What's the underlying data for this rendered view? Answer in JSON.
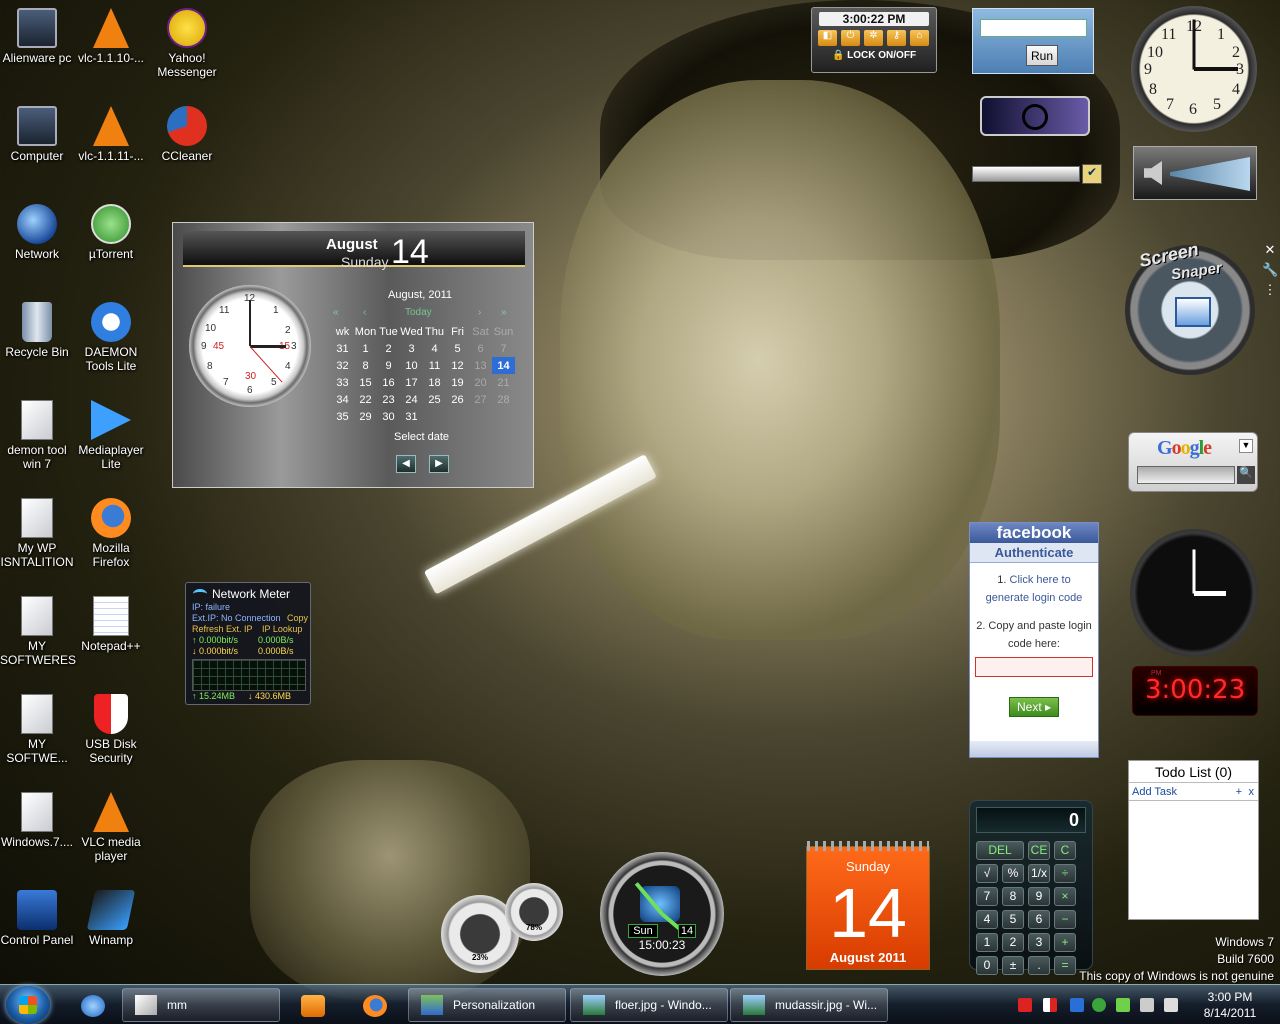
{
  "desktop_icons": [
    {
      "label": "Alienware pc",
      "icon": "monitor-icon"
    },
    {
      "label": "vlc-1.1.10-...",
      "icon": "vlc-icon"
    },
    {
      "label": "Yahoo! Messenger",
      "icon": "yahoo-messenger-icon"
    },
    {
      "label": "Computer",
      "icon": "computer-icon"
    },
    {
      "label": "vlc-1.1.11-...",
      "icon": "vlc-icon"
    },
    {
      "label": "CCleaner",
      "icon": "ccleaner-icon"
    },
    {
      "label": "Network",
      "icon": "network-icon"
    },
    {
      "label": "µTorrent",
      "icon": "utorrent-icon"
    },
    {
      "label": "Recycle Bin",
      "icon": "recycle-bin-icon"
    },
    {
      "label": "DAEMON Tools Lite",
      "icon": "daemon-tools-icon"
    },
    {
      "label": "demon tool win 7",
      "icon": "shortcut-doc-icon"
    },
    {
      "label": "Mediaplayer Lite",
      "icon": "mediaplayer-icon"
    },
    {
      "label": "My  WP ISNTALITION",
      "icon": "shortcut-doc-icon"
    },
    {
      "label": "Mozilla Firefox",
      "icon": "firefox-icon"
    },
    {
      "label": "MY SOFTWERES",
      "icon": "shortcut-doc-icon"
    },
    {
      "label": "Notepad++",
      "icon": "notepad-icon"
    },
    {
      "label": "MY SOFTWE...",
      "icon": "shortcut-doc-icon"
    },
    {
      "label": "USB Disk Security",
      "icon": "usb-disk-security-icon"
    },
    {
      "label": "Windows.7....",
      "icon": "shortcut-doc-icon"
    },
    {
      "label": "VLC media player",
      "icon": "vlc-icon"
    },
    {
      "label": "Control Panel",
      "icon": "control-panel-icon"
    },
    {
      "label": "Winamp",
      "icon": "winamp-icon"
    }
  ],
  "lock_gadget": {
    "time": "3:00:22 PM",
    "lock_label": "LOCK ON/OFF"
  },
  "run_gadget": {
    "button": "Run",
    "value": ""
  },
  "calendar_gadget": {
    "month": "August",
    "weekday": "Sunday",
    "day": "14",
    "month_year": "August, 2011",
    "today": "Today",
    "week_headers": [
      "wk",
      "Mon",
      "Tue",
      "Wed",
      "Thu",
      "Fri",
      "Sat",
      "Sun"
    ],
    "rows": [
      [
        "31",
        "1",
        "2",
        "3",
        "4",
        "5",
        "6",
        "7"
      ],
      [
        "32",
        "8",
        "9",
        "10",
        "11",
        "12",
        "13",
        "14"
      ],
      [
        "33",
        "15",
        "16",
        "17",
        "18",
        "19",
        "20",
        "21"
      ],
      [
        "34",
        "22",
        "23",
        "24",
        "25",
        "26",
        "27",
        "28"
      ],
      [
        "35",
        "29",
        "30",
        "31",
        "",
        "",
        "",
        ""
      ]
    ],
    "selected_date": "14",
    "select_date": "Select date",
    "clock_numbers": [
      "12",
      "1",
      "2",
      "3",
      "4",
      "5",
      "6",
      "7",
      "8",
      "9",
      "10",
      "11"
    ],
    "clock_red_marks": [
      "15",
      "30",
      "45"
    ]
  },
  "network_meter": {
    "title": "Network Meter",
    "ip": "IP: failure",
    "ext_ip": "Ext.IP: No Connection",
    "copy": "Copy",
    "refresh": "Refresh Ext. IP",
    "lookup": "IP Lookup",
    "up_rate": "0.000bit/s",
    "up_bytes": "0.000B/s",
    "down_rate": "0.000bit/s",
    "down_bytes": "0.000B/s",
    "total_up": "15.24MB",
    "total_down": "430.6MB"
  },
  "clock_gadget": {
    "numbers": [
      "12",
      "1",
      "2",
      "3",
      "4",
      "5",
      "6",
      "7",
      "8",
      "9",
      "10",
      "11"
    ],
    "time": "3:00"
  },
  "screen_snaper": {
    "title1": "Screen",
    "title2": "Snaper"
  },
  "google_gadget": {
    "logo": "Google",
    "query": ""
  },
  "digital_clock": {
    "ampm": "PM",
    "time": "3:00:23"
  },
  "facebook_gadget": {
    "title": "facebook",
    "subtitle": "Authenticate",
    "step1_prefix": "1.",
    "step1_link": "Click here to generate login code",
    "step2": "2. Copy and paste login code here:",
    "next": "Next ▸"
  },
  "todo_gadget": {
    "title": "Todo List (0)",
    "add_task": "Add Task",
    "plus": "+",
    "x": "x"
  },
  "calculator": {
    "display": "0",
    "keys": [
      "DEL",
      "CE",
      "C",
      "√",
      "%",
      "1/x",
      "÷",
      "7",
      "8",
      "9",
      "×",
      "4",
      "5",
      "6",
      "−",
      "1",
      "2",
      "3",
      "+",
      "0",
      "±",
      ".",
      "="
    ]
  },
  "date_calendar": {
    "weekday": "Sunday",
    "day": "14",
    "month_year": "August 2011"
  },
  "world_clock": {
    "weekday": "Sun",
    "day": "14",
    "time": "15:00:23"
  },
  "cpu_meter": {
    "cpu": "23%",
    "ram": "78%"
  },
  "windows_version": {
    "line1": "Windows 7",
    "line2": "Build 7600",
    "line3": "This copy of Windows is not genuine"
  },
  "taskbar": {
    "tasks": [
      {
        "label": "mm",
        "icon": "shortcut-doc-icon"
      },
      {
        "label": "Personalization",
        "icon": "personalization-icon"
      },
      {
        "label": "floer.jpg - Windo...",
        "icon": "photo-viewer-icon"
      },
      {
        "label": "mudassir.jpg - Wi...",
        "icon": "photo-viewer-icon"
      }
    ],
    "clock_time": "3:00 PM",
    "clock_date": "8/14/2011"
  }
}
